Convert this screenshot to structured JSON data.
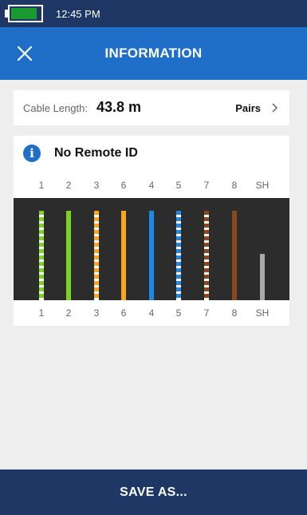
{
  "status_bar": {
    "time": "12:45 PM",
    "battery_level": 0.9,
    "battery_color": "#1a9a30"
  },
  "header": {
    "title": "INFORMATION",
    "close_icon": "close-icon"
  },
  "cable": {
    "label": "Cable Length:",
    "value": "43.8 m",
    "pairs_label": "Pairs",
    "pairs_icon": "chevron-right-icon"
  },
  "remote": {
    "icon": "info-icon",
    "icon_text": "i",
    "label": "No Remote ID"
  },
  "pins": [
    "1",
    "2",
    "3",
    "6",
    "4",
    "5",
    "7",
    "8",
    "SH"
  ],
  "wires": [
    {
      "pin": "1",
      "color": "#7ed321",
      "striped": true,
      "level": 1.0
    },
    {
      "pin": "2",
      "color": "#7ed321",
      "striped": false,
      "level": 1.0
    },
    {
      "pin": "3",
      "color": "#f5a623",
      "striped": true,
      "level": 1.0
    },
    {
      "pin": "6",
      "color": "#f5a623",
      "striped": false,
      "level": 1.0
    },
    {
      "pin": "4",
      "color": "#1e8ae6",
      "striped": false,
      "level": 1.0
    },
    {
      "pin": "5",
      "color": "#1e8ae6",
      "striped": true,
      "level": 1.0
    },
    {
      "pin": "7",
      "color": "#8b4a1e",
      "striped": true,
      "level": 1.0
    },
    {
      "pin": "8",
      "color": "#8b4a1e",
      "striped": false,
      "level": 1.0
    },
    {
      "pin": "SH",
      "color": "#a9a9a9",
      "striped": false,
      "level": 0.52
    }
  ],
  "footer": {
    "save_label": "SAVE AS..."
  },
  "colors": {
    "status_bar": "#1e3764",
    "header": "#1f6fc9",
    "footer": "#1e3764",
    "background": "#eeeeee",
    "wire_area": "#2c2c2c"
  }
}
